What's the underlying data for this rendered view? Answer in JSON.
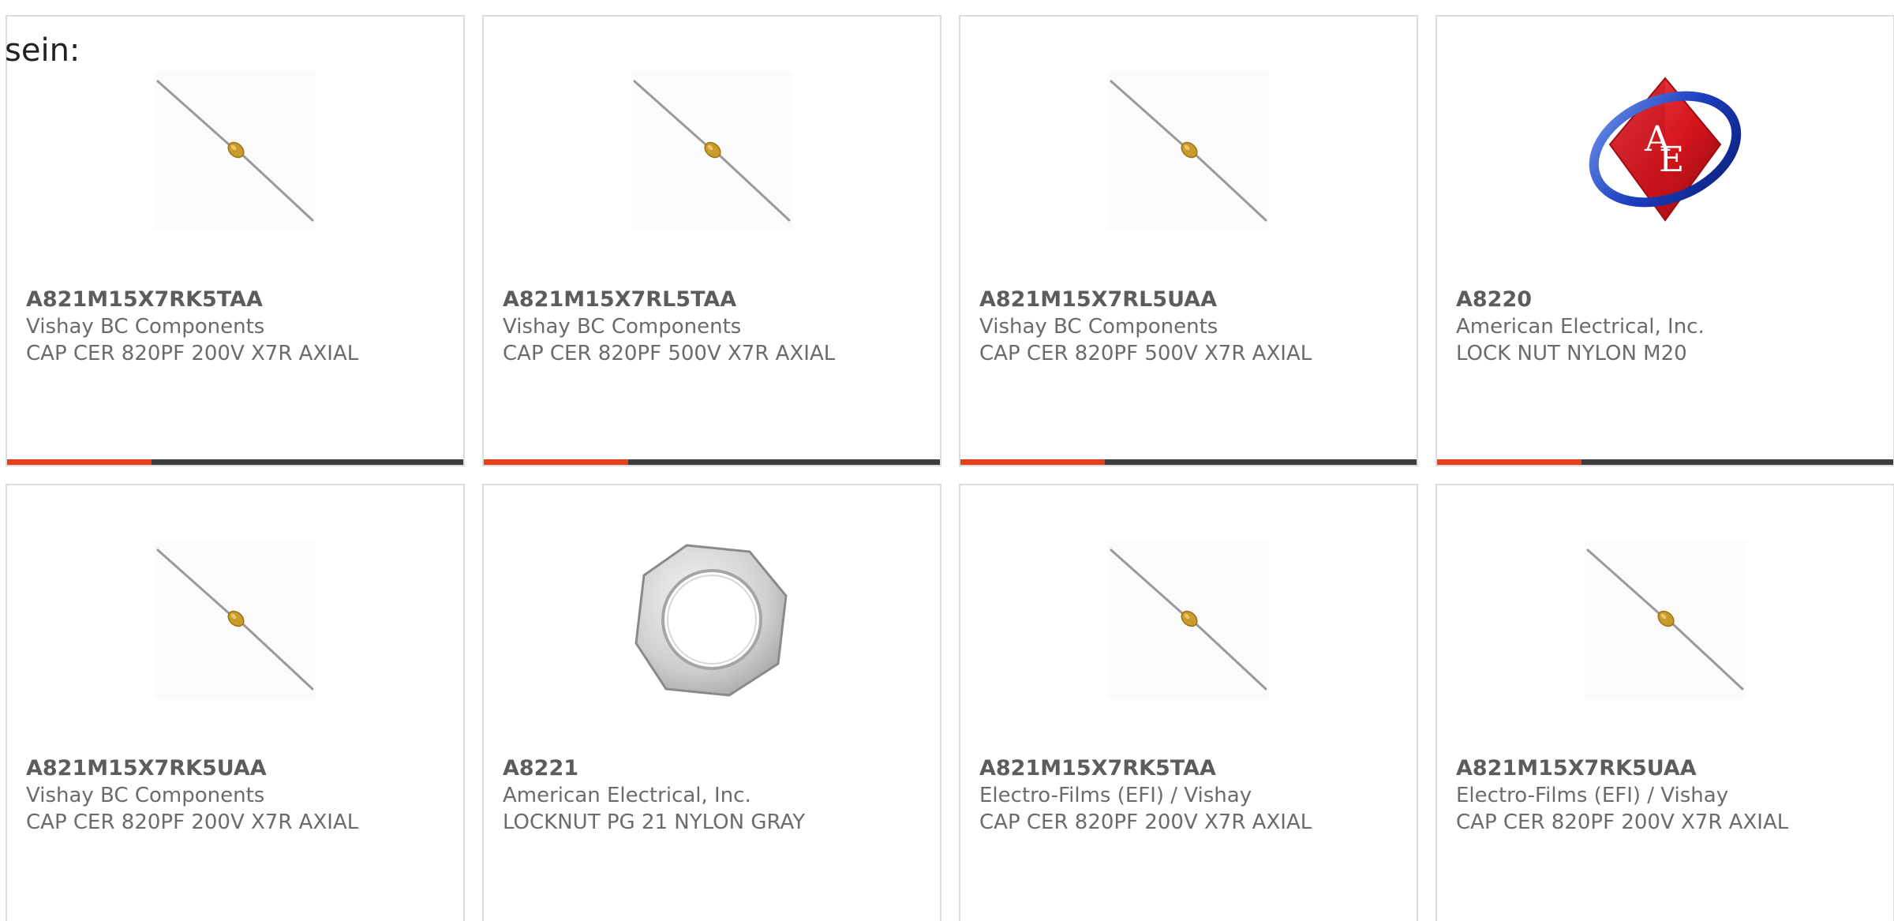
{
  "intro_text": "sein:",
  "colors": {
    "card_border": "#dcdcdc",
    "bar_dark": "#3d3d3d",
    "bar_accent": "#e8401c",
    "text_part": "#5c5c5c",
    "text_secondary": "#6b6b6b"
  },
  "products": [
    {
      "part": "A821M15X7RK5TAA",
      "manufacturer": "Vishay BC Components",
      "description": "CAP CER 820PF 200V X7R AXIAL",
      "image": "axial-capacitor-image"
    },
    {
      "part": "A821M15X7RL5TAA",
      "manufacturer": "Vishay BC Components",
      "description": "CAP CER 820PF 500V X7R AXIAL",
      "image": "axial-capacitor-image"
    },
    {
      "part": "A821M15X7RL5UAA",
      "manufacturer": "Vishay BC Components",
      "description": "CAP CER 820PF 500V X7R AXIAL",
      "image": "axial-capacitor-image"
    },
    {
      "part": "A8220",
      "manufacturer": "American Electrical, Inc.",
      "description": "LOCK NUT NYLON M20",
      "image": "ae-logo-image"
    },
    {
      "part": "A821M15X7RK5UAA",
      "manufacturer": "Vishay BC Components",
      "description": "CAP CER 820PF 200V X7R AXIAL",
      "image": "axial-capacitor-image"
    },
    {
      "part": "A8221",
      "manufacturer": "American Electrical, Inc.",
      "description": "LOCKNUT PG 21 NYLON GRAY",
      "image": "hex-locknut-image"
    },
    {
      "part": "A821M15X7RK5TAA",
      "manufacturer": "Electro-Films (EFI) / Vishay",
      "description": "CAP CER 820PF 200V X7R AXIAL",
      "image": "axial-capacitor-image"
    },
    {
      "part": "A821M15X7RK5UAA",
      "manufacturer": "Electro-Films (EFI) / Vishay",
      "description": "CAP CER 820PF 200V X7R AXIAL",
      "image": "axial-capacitor-image"
    }
  ],
  "logo_text": "AE"
}
